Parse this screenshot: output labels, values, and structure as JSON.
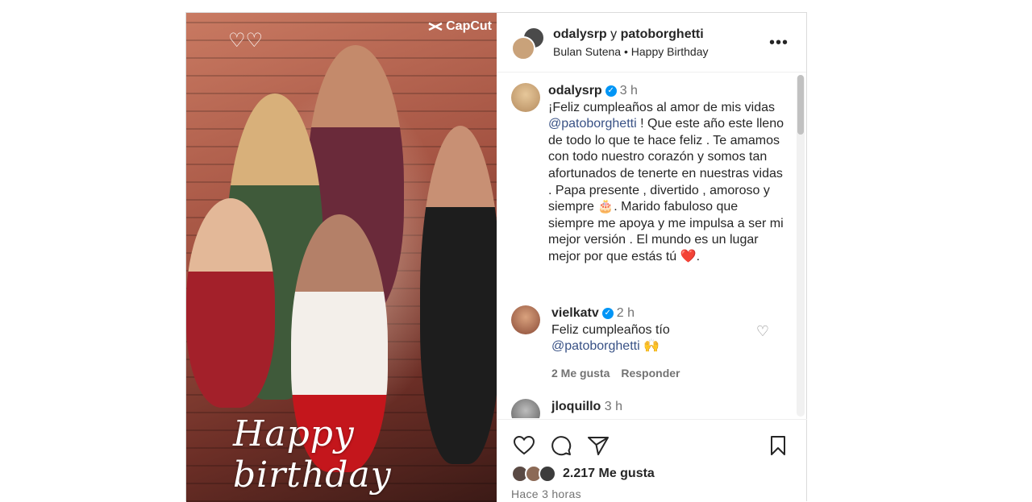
{
  "media": {
    "watermark": "CapCut",
    "overlay_text": "Happy birthday"
  },
  "header": {
    "user1": "odalysrp",
    "conjunction": "y",
    "user2": "patoborghetti",
    "audio_artist": "Bulan Sutena",
    "separator": "•",
    "audio_track": "Happy Birthday",
    "more_icon": "more-horizontal-icon"
  },
  "caption": {
    "username": "odalysrp",
    "time": "3 h",
    "text_part1": "¡Feliz cumpleaños al amor de mis vidas ",
    "mention": "@patoborghetti",
    "text_part2": " ! Que este año este lleno de todo lo que te hace feliz . Te amamos con todo nuestro corazón y somos tan afortunados de tenerte en nuestras vidas . Papa presente , divertido , amoroso y siempre ",
    "emoji1": "🎂",
    "text_part3": ". Marido fabuloso que siempre me apoya y me impulsa a ser mi mejor versión . El mundo es un lugar mejor por que estás tú ",
    "emoji2": "❤️",
    "text_part4": "."
  },
  "comments": [
    {
      "username": "vielkatv",
      "time": "2 h",
      "text": "Feliz cumpleaños tío",
      "mention": "@patoborghetti",
      "emoji": "🙌",
      "likes": "2 Me gusta",
      "reply": "Responder"
    },
    {
      "username": "jloquillo",
      "time": "3 h"
    }
  ],
  "actions": {
    "likes_count": "2.217 Me gusta",
    "time_ago": "Hace 3 horas"
  },
  "colors": {
    "link": "#385185",
    "verified": "#0095f6",
    "muted": "#737373"
  }
}
